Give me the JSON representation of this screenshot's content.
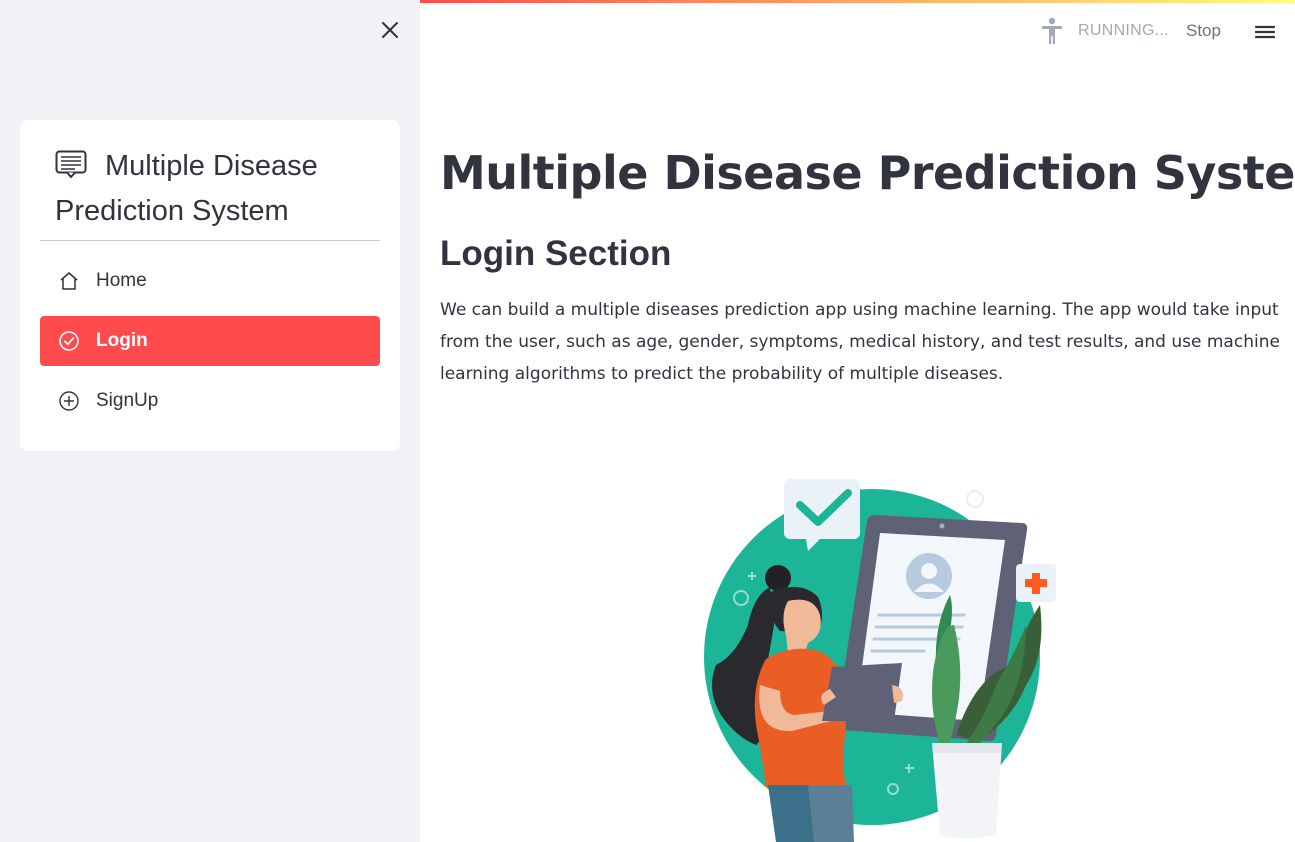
{
  "sidebar": {
    "menu_title": "Multiple Disease Prediction System",
    "items": [
      {
        "label": "Home",
        "icon": "house-icon",
        "selected": false
      },
      {
        "label": "Login",
        "icon": "check-circle-icon",
        "selected": true
      },
      {
        "label": "SignUp",
        "icon": "plus-circle-icon",
        "selected": false
      }
    ]
  },
  "header": {
    "status_text": "RUNNING...",
    "stop_label": "Stop"
  },
  "main": {
    "title": "Multiple Disease Prediction System",
    "section_title": "Login Section",
    "description": "We can build a multiple diseases prediction app using machine learning. The app would take input from the user, such as age, gender, symptoms, medical history, and test results, and use machine learning algorithms to predict the probability of multiple diseases."
  },
  "colors": {
    "accent": "#ff4b4b",
    "sidebar_bg": "#f0f2f6",
    "text": "#31333f",
    "illustration_teal": "#1db597"
  }
}
